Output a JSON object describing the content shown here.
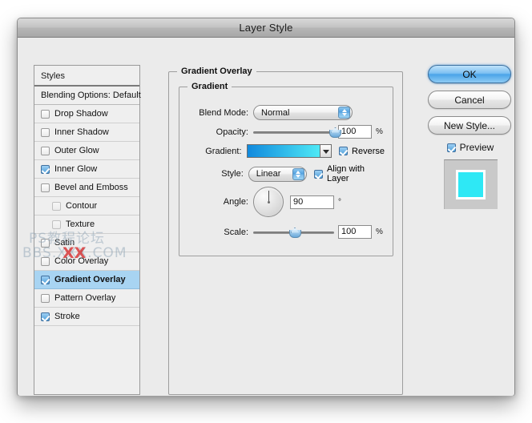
{
  "window": {
    "title": "Layer Style"
  },
  "styles_panel": {
    "header": "Styles",
    "blending": "Blending Options: Default",
    "items": [
      {
        "label": "Drop Shadow",
        "checked": false,
        "indent": false,
        "selected": false
      },
      {
        "label": "Inner Shadow",
        "checked": false,
        "indent": false,
        "selected": false
      },
      {
        "label": "Outer Glow",
        "checked": false,
        "indent": false,
        "selected": false
      },
      {
        "label": "Inner Glow",
        "checked": true,
        "indent": false,
        "selected": false
      },
      {
        "label": "Bevel and Emboss",
        "checked": false,
        "indent": false,
        "selected": false
      },
      {
        "label": "Contour",
        "checked": false,
        "indent": true,
        "selected": false
      },
      {
        "label": "Texture",
        "checked": false,
        "indent": true,
        "selected": false
      },
      {
        "label": "Satin",
        "checked": false,
        "indent": false,
        "selected": false
      },
      {
        "label": "Color Overlay",
        "checked": false,
        "indent": false,
        "selected": false
      },
      {
        "label": "Gradient Overlay",
        "checked": true,
        "indent": false,
        "selected": true
      },
      {
        "label": "Pattern Overlay",
        "checked": false,
        "indent": false,
        "selected": false
      },
      {
        "label": "Stroke",
        "checked": true,
        "indent": false,
        "selected": false
      }
    ]
  },
  "main_panel": {
    "outer_group_title": "Gradient Overlay",
    "inner_group_title": "Gradient",
    "blend_mode": {
      "label": "Blend Mode:",
      "value": "Normal"
    },
    "opacity": {
      "label": "Opacity:",
      "value": "100",
      "unit": "%",
      "percent": 100
    },
    "gradient": {
      "label": "Gradient:",
      "start_color": "#1189dd",
      "end_color": "#4ee9f6",
      "reverse_label": "Reverse",
      "reverse_checked": true
    },
    "style": {
      "label": "Style:",
      "value": "Linear",
      "align_label": "Align with Layer",
      "align_checked": true
    },
    "angle": {
      "label": "Angle:",
      "value": "90",
      "unit": "°",
      "degrees": 90
    },
    "scale": {
      "label": "Scale:",
      "value": "100",
      "unit": "%",
      "percent": 100
    }
  },
  "buttons": {
    "ok": "OK",
    "cancel": "Cancel",
    "new_style": "New Style...",
    "preview_label": "Preview",
    "preview_checked": true,
    "preview_swatch_color": "#2ee8f5"
  },
  "watermark": {
    "line1": "PS教程论坛",
    "line2": "BBS.XXX.COM",
    "mark": "XX"
  }
}
